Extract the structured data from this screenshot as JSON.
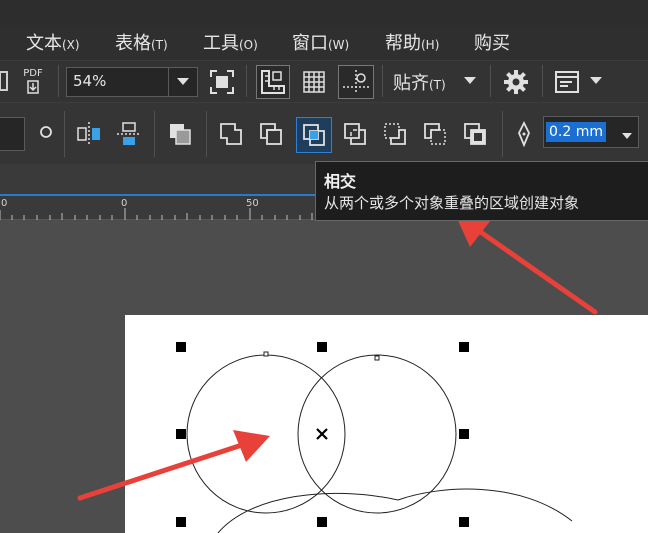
{
  "menu": [
    {
      "label": "文本",
      "accel": "(X)"
    },
    {
      "label": "表格",
      "accel": "(T)"
    },
    {
      "label": "工具",
      "accel": "(O)"
    },
    {
      "label": "窗口",
      "accel": "(W)"
    },
    {
      "label": "帮助",
      "accel": "(H)"
    },
    {
      "label": "购买",
      "accel": ""
    }
  ],
  "toolbar": {
    "pdf_label": "PDF",
    "zoom_value": "54%",
    "snap_label": "贴齐",
    "snap_accel": "(T)"
  },
  "property_bar": {
    "outline_width": "0.2 mm"
  },
  "ruler": {
    "ticks": [
      "0",
      "0",
      "50"
    ]
  },
  "tooltip": {
    "title": "相交",
    "description": "从两个或多个对象重叠的区域创建对象"
  },
  "icons": [
    "pdf-export-icon",
    "full-screen-icon",
    "ruler-icon",
    "grid-icon",
    "guidelines-icon",
    "gear-icon",
    "launch-icon",
    "chevron-down-icon",
    "circle-tool-icon",
    "mirror-horizontal-icon",
    "mirror-vertical-icon",
    "combine-icon",
    "weld-icon",
    "trim-icon",
    "intersect-icon",
    "simplify-icon",
    "front-minus-back-icon",
    "back-minus-front-icon",
    "boundary-icon",
    "pen-nib-icon"
  ],
  "colors": {
    "accent": "#2f7fd2",
    "highlight": "#1b6fd1",
    "arrow": "#e8413a"
  }
}
